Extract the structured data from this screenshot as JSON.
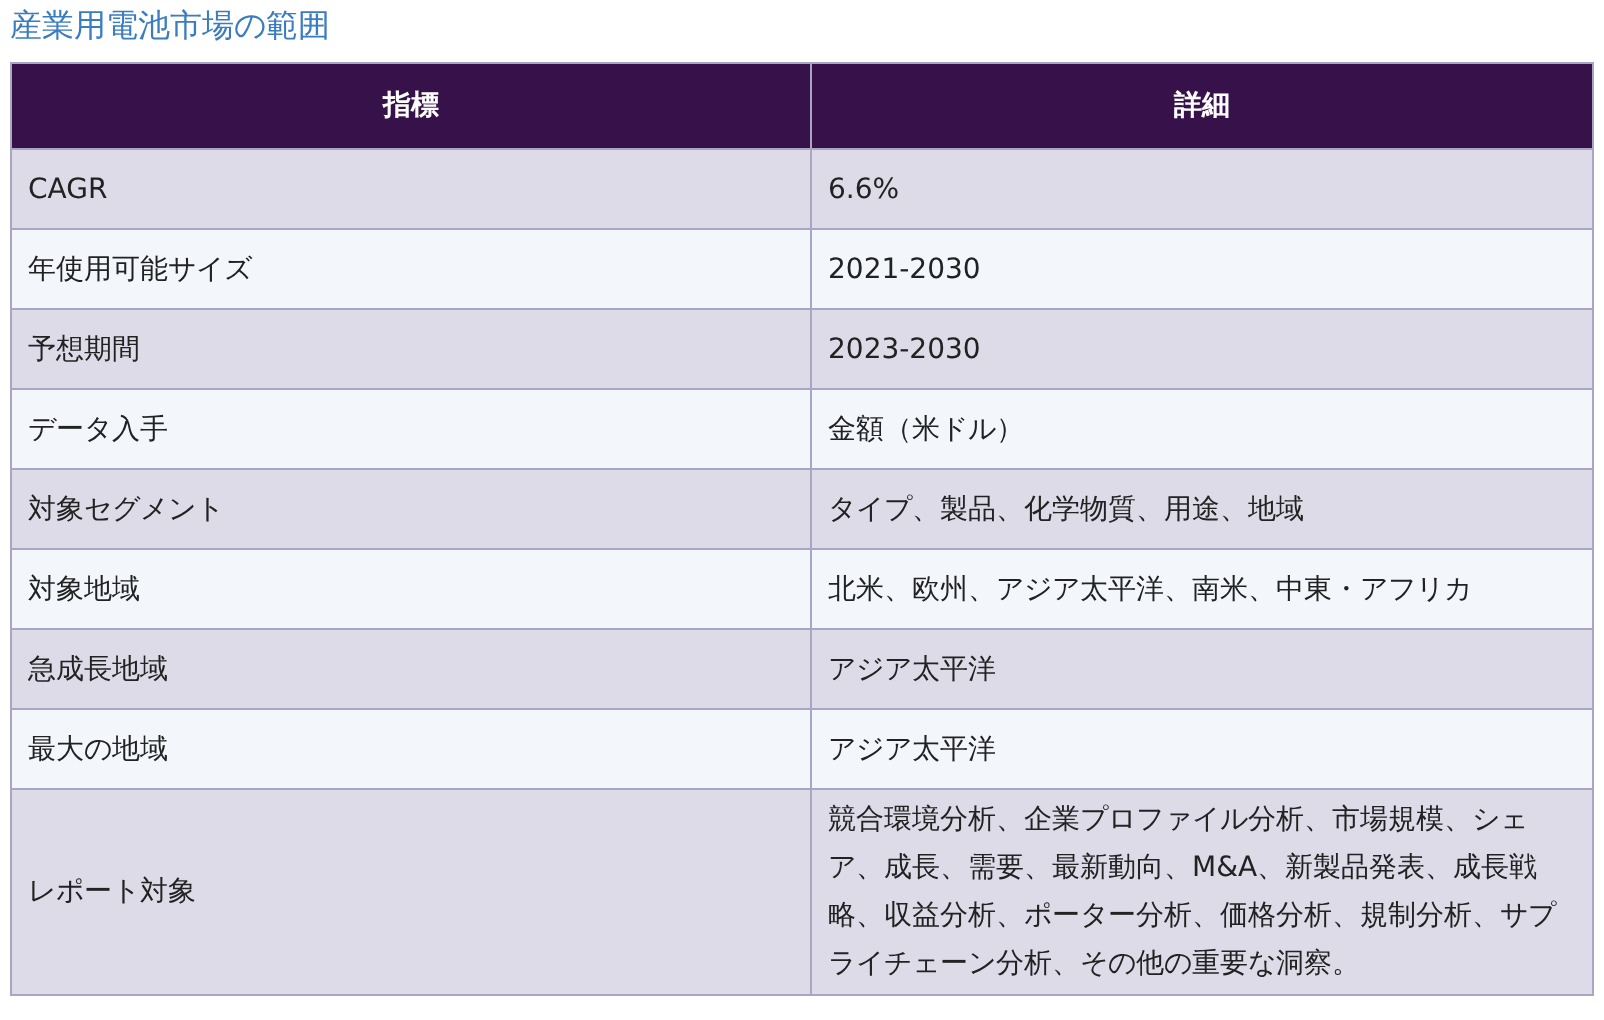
{
  "title": "産業用電池市場の範囲",
  "table": {
    "columns": [
      "指標",
      "詳細"
    ],
    "rows": [
      {
        "metric": "CAGR",
        "detail": "6.6%"
      },
      {
        "metric": "年使用可能サイズ",
        "detail": "2021-2030"
      },
      {
        "metric": "予想期間",
        "detail": "2023-2030"
      },
      {
        "metric": "データ入手",
        "detail": "金額（米ドル）"
      },
      {
        "metric": "対象セグメント",
        "detail": "タイプ、製品、化学物質、用途、地域"
      },
      {
        "metric": "対象地域",
        "detail": "北米、欧州、アジア太平洋、南米、中東・アフリカ"
      },
      {
        "metric": "急成長地域",
        "detail": "アジア太平洋"
      },
      {
        "metric": "最大の地域",
        "detail": "アジア太平洋"
      },
      {
        "metric": "レポート対象",
        "detail": "競合環境分析、企業プロファイル分析、市場規模、シェア、成長、需要、最新動向、M&A、新製品発表、成長戦略、収益分析、ポーター分析、価格分析、規制分析、サプライチェーン分析、その他の重要な洞察。"
      }
    ]
  }
}
